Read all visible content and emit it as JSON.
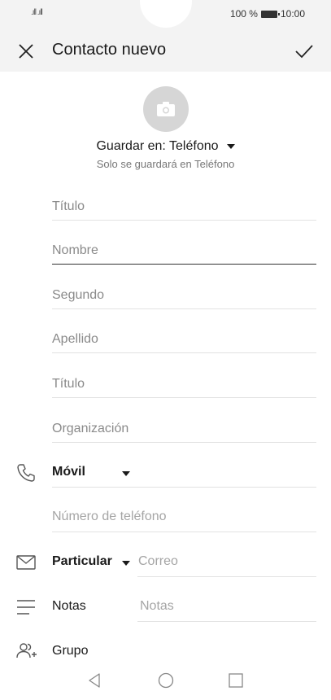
{
  "status_bar": {
    "signal_left": ".ıll .ıll",
    "battery": "100 %",
    "time": "10:00"
  },
  "header": {
    "title": "Contacto nuevo"
  },
  "storage": {
    "label": "Guardar en: Teléfono",
    "note": "Solo se guardará en Teléfono"
  },
  "fields": [
    "Título",
    "Nombre",
    "Segundo",
    "Apellido",
    "Título",
    "Organización"
  ],
  "phone": {
    "type": "Móvil",
    "placeholder": "Número de teléfono"
  },
  "email": {
    "type": "Particular",
    "placeholder": "Correo"
  },
  "notes": {
    "label": "Notas",
    "placeholder": "Notas"
  },
  "group": {
    "label": "Grupo"
  },
  "icons": {
    "close": "close-icon",
    "confirm": "check-icon",
    "camera": "camera-icon",
    "phone": "phone-icon",
    "email": "mail-icon",
    "notes": "notes-icon",
    "group": "group-icon"
  }
}
